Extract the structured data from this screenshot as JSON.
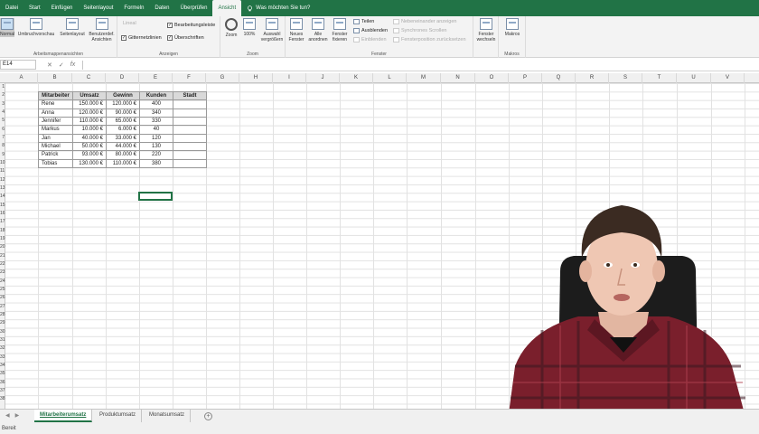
{
  "ribbon_tabs": [
    "Datei",
    "Start",
    "Einfügen",
    "Seitenlayout",
    "Formeln",
    "Daten",
    "Überprüfen",
    "Ansicht"
  ],
  "active_tab_index": 7,
  "tell_me": "Was möchten Sie tun?",
  "groups": {
    "workbook_views": {
      "label": "Arbeitsmappenansichten",
      "buttons": [
        "Normal",
        "Umbruchvorschau",
        "Seitenlayout",
        "Benutzerdef. Ansichten"
      ]
    },
    "show": {
      "label": "Anzeigen",
      "lineal": "Lineal",
      "gitternetz": "Gitternetzlinien",
      "bearbeitungsleiste": "Bearbeitungsleiste",
      "ueberschriften": "Überschriften"
    },
    "zoom": {
      "label": "Zoom",
      "buttons": [
        "Zoom",
        "100%",
        "Auswahl vergrößern"
      ]
    },
    "window": {
      "label": "Fenster",
      "buttons": [
        "Neues Fenster",
        "Alle anordnen",
        "Fenster fixieren"
      ],
      "small": [
        "Teilen",
        "Ausblenden",
        "Einblenden"
      ],
      "disabled_small": [
        "Nebeneinander anzeigen",
        "Synchrones Scrollen",
        "Fensterposition zurücksetzen"
      ],
      "switch": "Fenster wechseln"
    },
    "macros": {
      "label": "Makros",
      "button": "Makros"
    }
  },
  "formula_bar": {
    "name_box": "E14",
    "cancel": "✕",
    "enter": "✓",
    "fx": "fx",
    "value": ""
  },
  "columns": [
    "A",
    "B",
    "C",
    "D",
    "E",
    "F",
    "G",
    "H",
    "I",
    "J",
    "K",
    "L",
    "M",
    "N",
    "O",
    "P",
    "Q",
    "R",
    "S",
    "T",
    "U",
    "V"
  ],
  "rows": [
    "1",
    "2",
    "3",
    "4",
    "5",
    "6",
    "7",
    "8",
    "9",
    "10",
    "11",
    "12",
    "13",
    "14",
    "15",
    "16",
    "17",
    "18",
    "19",
    "20",
    "21",
    "22",
    "23",
    "24",
    "25",
    "26",
    "27",
    "28",
    "29",
    "30",
    "31",
    "32",
    "33",
    "34",
    "35",
    "36",
    "37",
    "38"
  ],
  "table": {
    "headers": [
      "Mitarbeiter",
      "Umsatz",
      "Gewinn",
      "Kunden",
      "Stadt"
    ],
    "rows": [
      [
        "Rene",
        "150.000 €",
        "120.000 €",
        "400",
        ""
      ],
      [
        "Anna",
        "120.000 €",
        "90.000 €",
        "340",
        ""
      ],
      [
        "Jennifer",
        "110.000 €",
        "65.000 €",
        "330",
        ""
      ],
      [
        "Markus",
        "10.000 €",
        "6.000 €",
        "40",
        ""
      ],
      [
        "Jan",
        "40.000 €",
        "33.000 €",
        "120",
        ""
      ],
      [
        "Michael",
        "50.000 €",
        "44.000 €",
        "130",
        ""
      ],
      [
        "Patrick",
        "93.000 €",
        "80.000 €",
        "220",
        ""
      ],
      [
        "Tobias",
        "130.000 €",
        "110.000 €",
        "380",
        ""
      ]
    ]
  },
  "sheets": [
    "Mitarbeiterumsatz",
    "Produktumsatz",
    "Monatsumsatz"
  ],
  "active_sheet_index": 0,
  "add_sheet": "+",
  "status": "Bereit",
  "colors": {
    "accent": "#217346",
    "ribbon": "#f3f3f3",
    "shirt_red": "#7a1f2c"
  }
}
